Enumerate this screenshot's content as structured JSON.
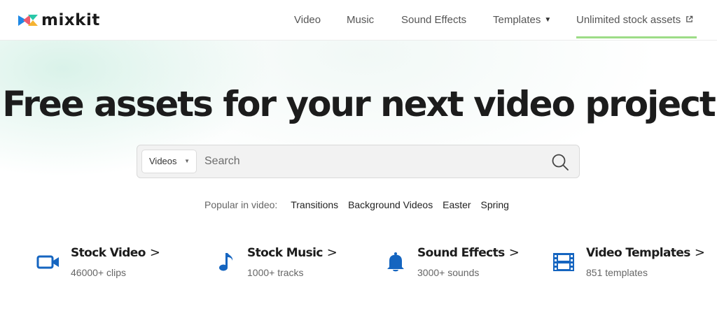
{
  "brand": {
    "name": "mixkit",
    "accent": "#9cdc86",
    "icon_blue": "#1565c0"
  },
  "nav": {
    "items": [
      {
        "label": "Video"
      },
      {
        "label": "Music"
      },
      {
        "label": "Sound Effects"
      },
      {
        "label": "Templates"
      },
      {
        "label": "Unlimited stock assets"
      }
    ]
  },
  "hero": {
    "title": "Free assets for your next video project"
  },
  "search": {
    "category": "Videos",
    "placeholder": "Search"
  },
  "popular": {
    "label": "Popular in video:",
    "links": [
      "Transitions",
      "Background Videos",
      "Easter",
      "Spring"
    ]
  },
  "categories": [
    {
      "title": "Stock Video",
      "subtitle": "46000+ clips",
      "icon": "video-camera-icon"
    },
    {
      "title": "Stock Music",
      "subtitle": "1000+ tracks",
      "icon": "music-note-icon"
    },
    {
      "title": "Sound Effects",
      "subtitle": "3000+ sounds",
      "icon": "bell-icon"
    },
    {
      "title": "Video Templates",
      "subtitle": "851 templates",
      "icon": "film-strip-icon"
    }
  ]
}
